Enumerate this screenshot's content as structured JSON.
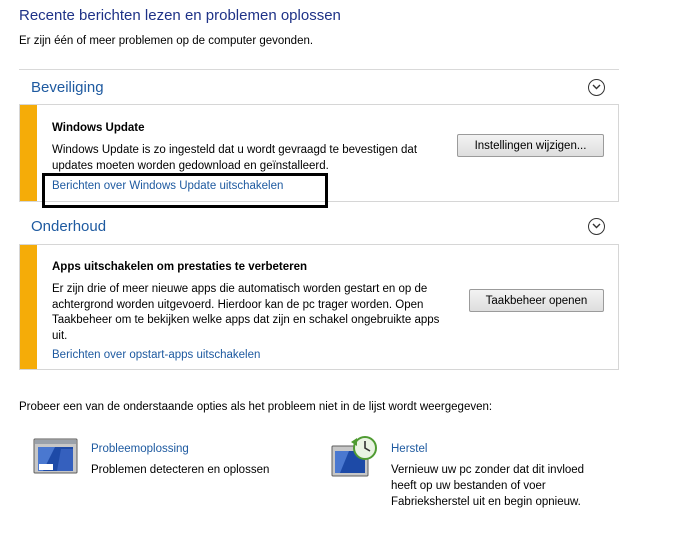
{
  "header": {
    "title": "Recente berichten lezen en problemen oplossen",
    "subtitle": "Er zijn één of meer problemen op de computer gevonden."
  },
  "security": {
    "heading": "Beveiliging",
    "card": {
      "title": "Windows Update",
      "text": "Windows Update is zo ingesteld dat u wordt gevraagd te bevestigen dat updates moeten worden gedownload en geïnstalleerd.",
      "link": "Berichten over Windows Update uitschakelen",
      "button": "Instellingen wijzigen..."
    }
  },
  "maintenance": {
    "heading": "Onderhoud",
    "card": {
      "title": "Apps uitschakelen om prestaties te verbeteren",
      "text": "Er zijn drie of meer nieuwe apps die automatisch worden gestart en op de achtergrond worden uitgevoerd. Hierdoor kan de pc trager worden. Open Taakbeheer om te bekijken welke apps dat zijn en schakel ongebruikte apps uit.",
      "link": "Berichten over opstart-apps uitschakelen",
      "button": "Taakbeheer openen"
    }
  },
  "footer": {
    "text": "Probeer een van de onderstaande opties als het probleem niet in de lijst wordt weergegeven:",
    "options": [
      {
        "title": "Probleemoplossing",
        "description": "Problemen detecteren en oplossen",
        "icon": "troubleshooting-icon"
      },
      {
        "title": "Herstel",
        "description": "Vernieuw uw pc zonder dat dit invloed heeft op uw bestanden of voer Fabrieksherstel uit en begin opnieuw.",
        "icon": "recovery-icon"
      }
    ]
  },
  "colors": {
    "title": "#1e3287",
    "link": "#1e5aa0",
    "stripe": "#f5ac08"
  }
}
